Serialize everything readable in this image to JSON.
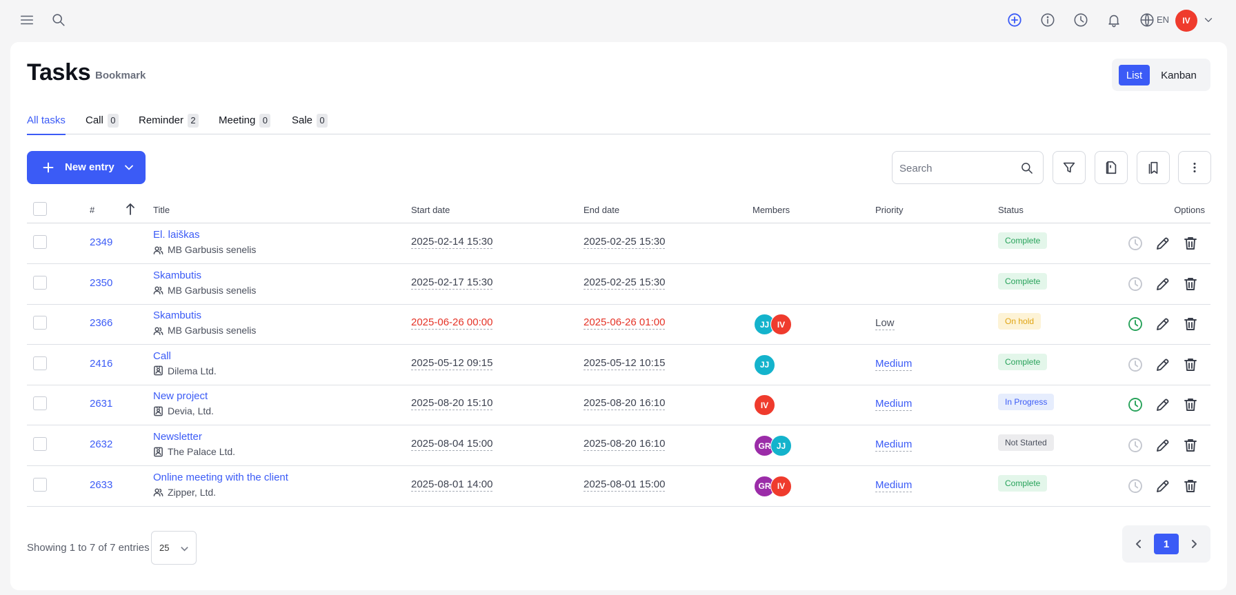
{
  "header": {
    "language": "EN",
    "user_initials": "IV",
    "user_color": "#ef3b2d"
  },
  "page": {
    "title": "Tasks",
    "subtitle": "Bookmark"
  },
  "view_toggle": {
    "list": "List",
    "kanban": "Kanban",
    "active": "List"
  },
  "tabs": [
    {
      "label": "All tasks",
      "count": null
    },
    {
      "label": "Call",
      "count": "0"
    },
    {
      "label": "Reminder",
      "count": "2"
    },
    {
      "label": "Meeting",
      "count": "0"
    },
    {
      "label": "Sale",
      "count": "0"
    }
  ],
  "toolbar": {
    "new_entry": "New entry",
    "search_placeholder": "Search"
  },
  "table": {
    "columns": {
      "id": "#",
      "title": "Title",
      "start": "Start date",
      "end": "End date",
      "members": "Members",
      "priority": "Priority",
      "status": "Status",
      "options": "Options"
    },
    "rows": [
      {
        "id": "2349",
        "title": "El. laiškas",
        "related": "MB Garbusis senelis",
        "related_icon": "users-icon",
        "start": "2025-02-14 15:30",
        "end": "2025-02-25 15:30",
        "overdue": false,
        "members": [],
        "priority": "",
        "status": "Complete",
        "timer_active": false
      },
      {
        "id": "2350",
        "title": "Skambutis",
        "related": "MB Garbusis senelis",
        "related_icon": "users-icon",
        "start": "2025-02-17 15:30",
        "end": "2025-02-25 15:30",
        "overdue": false,
        "members": [],
        "priority": "",
        "status": "Complete",
        "timer_active": false
      },
      {
        "id": "2366",
        "title": "Skambutis",
        "related": "MB Garbusis senelis",
        "related_icon": "users-icon",
        "start": "2025-06-26 00:00",
        "end": "2025-06-26 01:00",
        "overdue": true,
        "members": [
          "JJ",
          "IV"
        ],
        "priority": "Low",
        "status": "On hold",
        "timer_active": true
      },
      {
        "id": "2416",
        "title": "Call",
        "related": "Dilema Ltd.",
        "related_icon": "contact-card-icon",
        "start": "2025-05-12 09:15",
        "end": "2025-05-12 10:15",
        "overdue": false,
        "members": [
          "JJ"
        ],
        "priority": "Medium",
        "status": "Complete",
        "timer_active": false
      },
      {
        "id": "2631",
        "title": "New project",
        "related": "Devia, Ltd.",
        "related_icon": "contact-card-icon",
        "start": "2025-08-20 15:10",
        "end": "2025-08-20 16:10",
        "overdue": false,
        "members": [
          "IV"
        ],
        "priority": "Medium",
        "status": "In Progress",
        "timer_active": true
      },
      {
        "id": "2632",
        "title": "Newsletter",
        "related": "The Palace Ltd.",
        "related_icon": "contact-card-icon",
        "start": "2025-08-04 15:00",
        "end": "2025-08-20 16:10",
        "overdue": false,
        "members": [
          "GR",
          "JJ"
        ],
        "priority": "Medium",
        "status": "Not Started",
        "timer_active": false
      },
      {
        "id": "2633",
        "title": "Online meeting with the client",
        "related": "Zipper, Ltd.",
        "related_icon": "users-icon",
        "start": "2025-08-01 14:00",
        "end": "2025-08-01 15:00",
        "overdue": false,
        "members": [
          "GR",
          "IV"
        ],
        "priority": "Medium",
        "status": "Complete",
        "timer_active": false
      }
    ]
  },
  "member_colors": {
    "JJ": "#14b3cc",
    "IV": "#ef3b2d",
    "GR": "#9b2ca8"
  },
  "status_styles": {
    "Complete": {
      "bg": "#e3f6ea",
      "fg": "#27a25a"
    },
    "On hold": {
      "bg": "#fdf3d6",
      "fg": "#e0a413"
    },
    "In Progress": {
      "bg": "#e6edfd",
      "fg": "#3b5bf6"
    },
    "Not Started": {
      "bg": "#ececee",
      "fg": "#4a4f5c"
    }
  },
  "priority_colors": {
    "Low": "#4a4f5c",
    "Medium": "#3b5bf6"
  },
  "footer": {
    "showing": "Showing 1 to 7 of 7 entries",
    "per_page": "25",
    "current_page": "1"
  }
}
